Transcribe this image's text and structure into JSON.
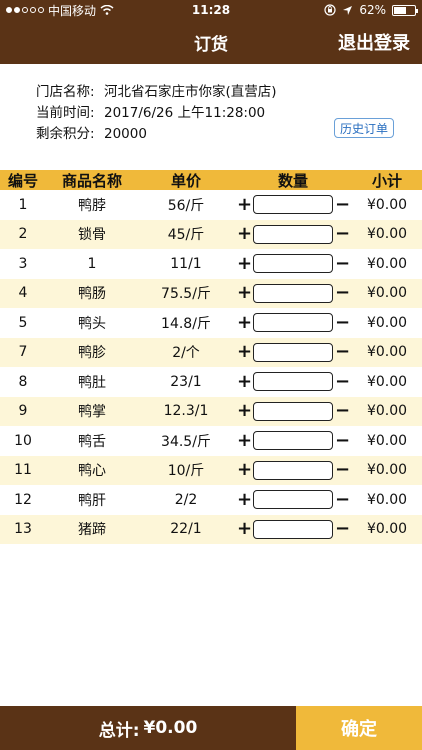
{
  "status": {
    "carrier": "中国移动",
    "time": "11:28",
    "battery": "62%",
    "battery_level": 0.62
  },
  "nav": {
    "title": "订货",
    "logout_label": "退出登录"
  },
  "info": {
    "store_label": "门店名称:",
    "store_value": "河北省石家庄市你家(直营店)",
    "time_label": "当前时间:",
    "time_value": "2017/6/26 上午11:28:00",
    "points_label": "剩余积分:",
    "points_value": "20000",
    "history_label": "历史订单"
  },
  "table": {
    "headers": [
      "编号",
      "商品名称",
      "单价",
      "数量",
      "小计"
    ],
    "plus": "+",
    "minus": "−",
    "rows": [
      {
        "id": "1",
        "name": "鸭脖",
        "price": "56/斤",
        "subtotal": "¥0.00"
      },
      {
        "id": "2",
        "name": "锁骨",
        "price": "45/斤",
        "subtotal": "¥0.00"
      },
      {
        "id": "3",
        "name": "1",
        "price": "11/1",
        "subtotal": "¥0.00"
      },
      {
        "id": "4",
        "name": "鸭肠",
        "price": "75.5/斤",
        "subtotal": "¥0.00"
      },
      {
        "id": "5",
        "name": "鸭头",
        "price": "14.8/斤",
        "subtotal": "¥0.00"
      },
      {
        "id": "7",
        "name": "鸭胗",
        "price": "2/个",
        "subtotal": "¥0.00"
      },
      {
        "id": "8",
        "name": "鸭肚",
        "price": "23/1",
        "subtotal": "¥0.00"
      },
      {
        "id": "9",
        "name": "鸭掌",
        "price": "12.3/1",
        "subtotal": "¥0.00"
      },
      {
        "id": "10",
        "name": "鸭舌",
        "price": "34.5/斤",
        "subtotal": "¥0.00"
      },
      {
        "id": "11",
        "name": "鸭心",
        "price": "10/斤",
        "subtotal": "¥0.00"
      },
      {
        "id": "12",
        "name": "鸭肝",
        "price": "2/2",
        "subtotal": "¥0.00"
      },
      {
        "id": "13",
        "name": "猪蹄",
        "price": "22/1",
        "subtotal": "¥0.00"
      }
    ]
  },
  "footer": {
    "total_label": "总计:",
    "total_value": "¥0.00",
    "confirm_label": "确定"
  },
  "colors": {
    "brand_brown": "#5a3316",
    "accent_yellow": "#f0b93a",
    "row_alt": "#fdf6d8"
  }
}
